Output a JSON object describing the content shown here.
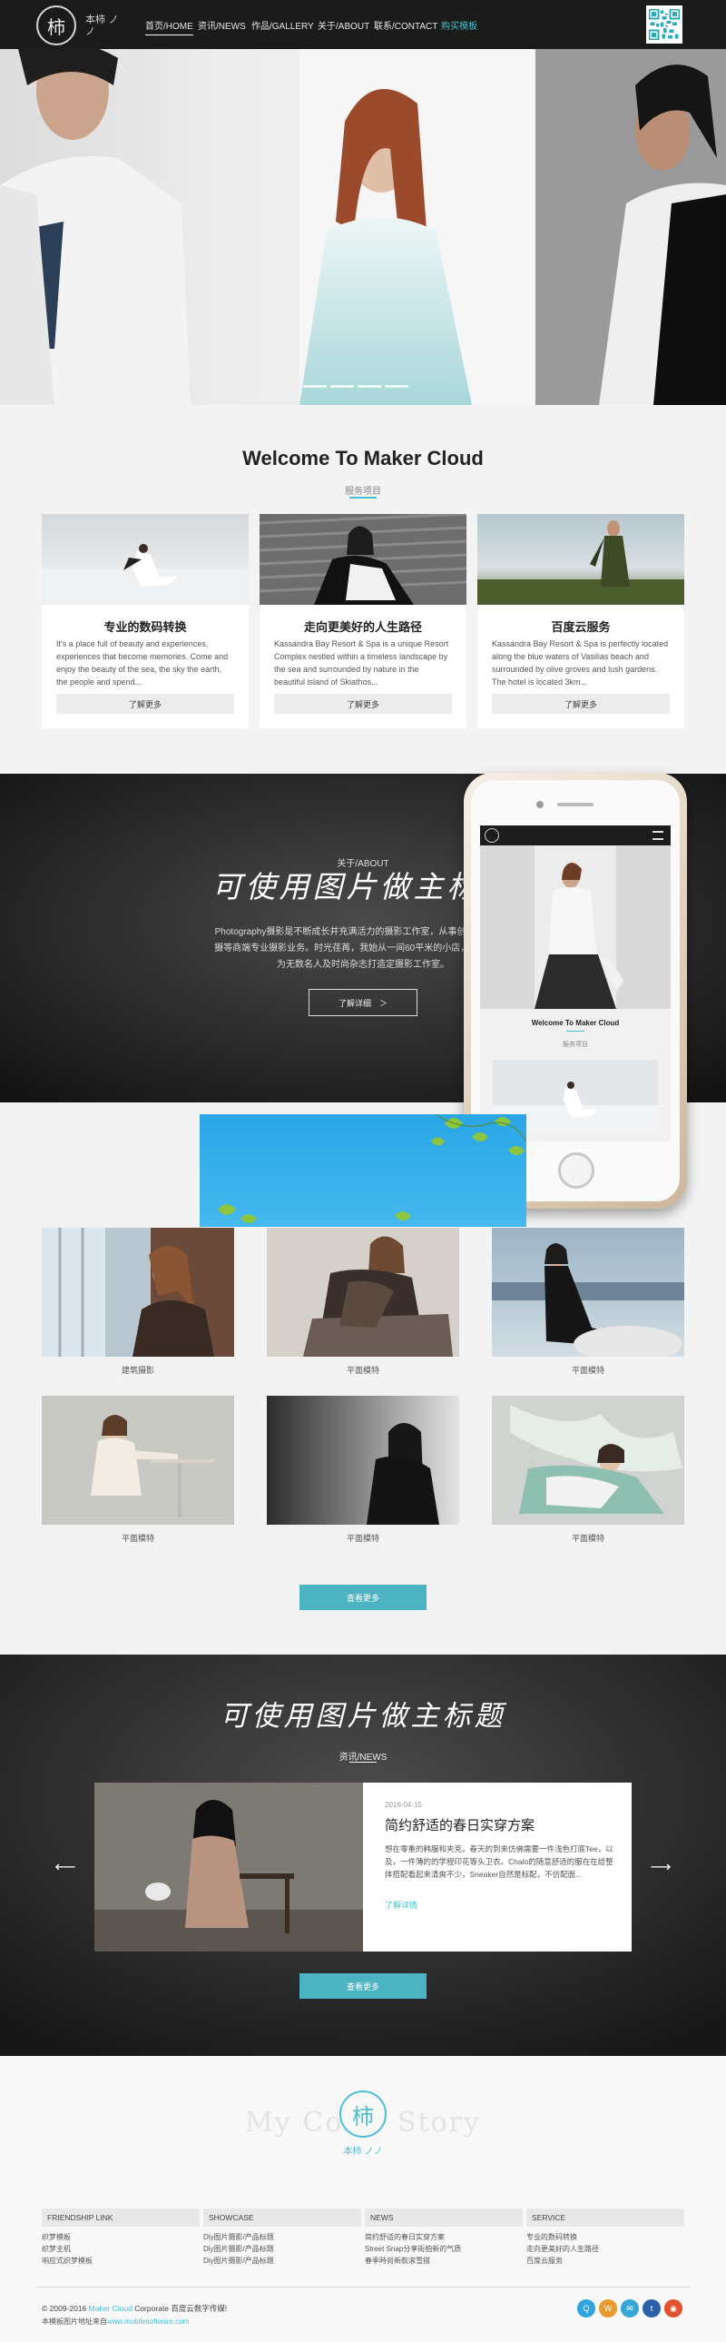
{
  "header": {
    "logo_glyph": "柿",
    "logo_sub": "本柿 ノノ",
    "nav": [
      "首页/HOME",
      "资讯/NEWS",
      "作品/GALLERY",
      "关于/ABOUT",
      "联系/CONTACT",
      "购买模板"
    ],
    "accent_color": "#4bc0cf"
  },
  "welcome": {
    "title": "Welcome To Maker Cloud",
    "subtitle": "服务项目",
    "cards": [
      {
        "title": "专业的数码转换",
        "desc": "It's a place full of beauty and experiences, experiences that become memories. Come and enjoy the beauty of the sea, the sky the earth, the people and spend...",
        "button": "了解更多"
      },
      {
        "title": "走向更美好的人生路径",
        "desc": "Kassandra Bay Resort & Spa is a unique Resort Complex nestled within a timeless landscape by the sea and surrounded by nature in the beautiful island of Skiathos...",
        "button": "了解更多"
      },
      {
        "title": "百度云服务",
        "desc": "Kassandra Bay Resort & Spa is perfectly located along the blue waters of Vasilias beach and surrounded by olive groves and lush gardens. The hotel is located 3km...",
        "button": "了解更多"
      }
    ]
  },
  "about": {
    "label": "关于/ABOUT",
    "title": "可使用图片做主标题",
    "text_line1": "Photography摄影是不断成长并充满活力的摄影工作室，从事创意摄影、专",
    "text_line2": "摄等商端专业摄影业务。时光荏苒，我始从一间60平米的小店，发展到150",
    "text_line3": "为无数名人及时尚杂志打造定摄影工作室。",
    "button": "了解详细　＞"
  },
  "phone": {
    "title": "Welcome To Maker Cloud",
    "subtitle": "服务项目"
  },
  "gallery": {
    "items": [
      {
        "caption": "建筑摄影"
      },
      {
        "caption": "平面模特"
      },
      {
        "caption": "平面模特"
      },
      {
        "caption": "平面模特"
      },
      {
        "caption": "平面模特"
      },
      {
        "caption": "平面模特"
      }
    ],
    "more_button": "查看更多"
  },
  "news": {
    "title": "可使用图片做主标题",
    "label": "资讯/NEWS",
    "date": "2016-04-15",
    "headline": "简约舒适的春日实穿方案",
    "desc": "想在零重的韩服和夹克，春天的到来仿佛需要一件浅色打底Tee，以及，一件薄的的学程印花等头卫衣。Chalo的随意舒适的服在在给整体搭配看起来清爽不少，Sneaker自然是标配，不仿配面...",
    "more": "了解详情",
    "prev_arrow": "⟵",
    "next_arrow": "⟶",
    "button": "查看更多"
  },
  "footer": {
    "story": "My Color Story",
    "story_logo": "柿",
    "story_sub": "本柿 ノノ",
    "columns": [
      {
        "heading": "FRIENDSHIP LINK",
        "links": [
          "织梦模板",
          "织梦主机",
          "响应式织梦模板"
        ]
      },
      {
        "heading": "SHOWCASE",
        "links": [
          "Diy图片摄影/产品标题",
          "Diy图片摄影/产品标题",
          "Diy图片摄影/产品标题"
        ]
      },
      {
        "heading": "NEWS",
        "links": [
          "简约舒适的春日实穿方案",
          "Street Snap分享街拍新的气质",
          "春季時尚新款滚雪搭"
        ]
      },
      {
        "heading": "SERVICE",
        "links": [
          "专业的数码转换",
          "走向更美好的人生路径",
          "百度云服务"
        ]
      }
    ],
    "copyright_pre": "© 2009-2016 ",
    "copyright_brand": "Maker Cloud",
    "copyright_post": " Corporate 百度云数字传媒!",
    "icp_pre": "本模板图片地址来自",
    "icp_link": "www.mobilesoftware.com",
    "social_icons": [
      "qq-icon",
      "weibo-icon",
      "wechat-icon",
      "tencent-weibo-icon",
      "rss-icon"
    ]
  }
}
